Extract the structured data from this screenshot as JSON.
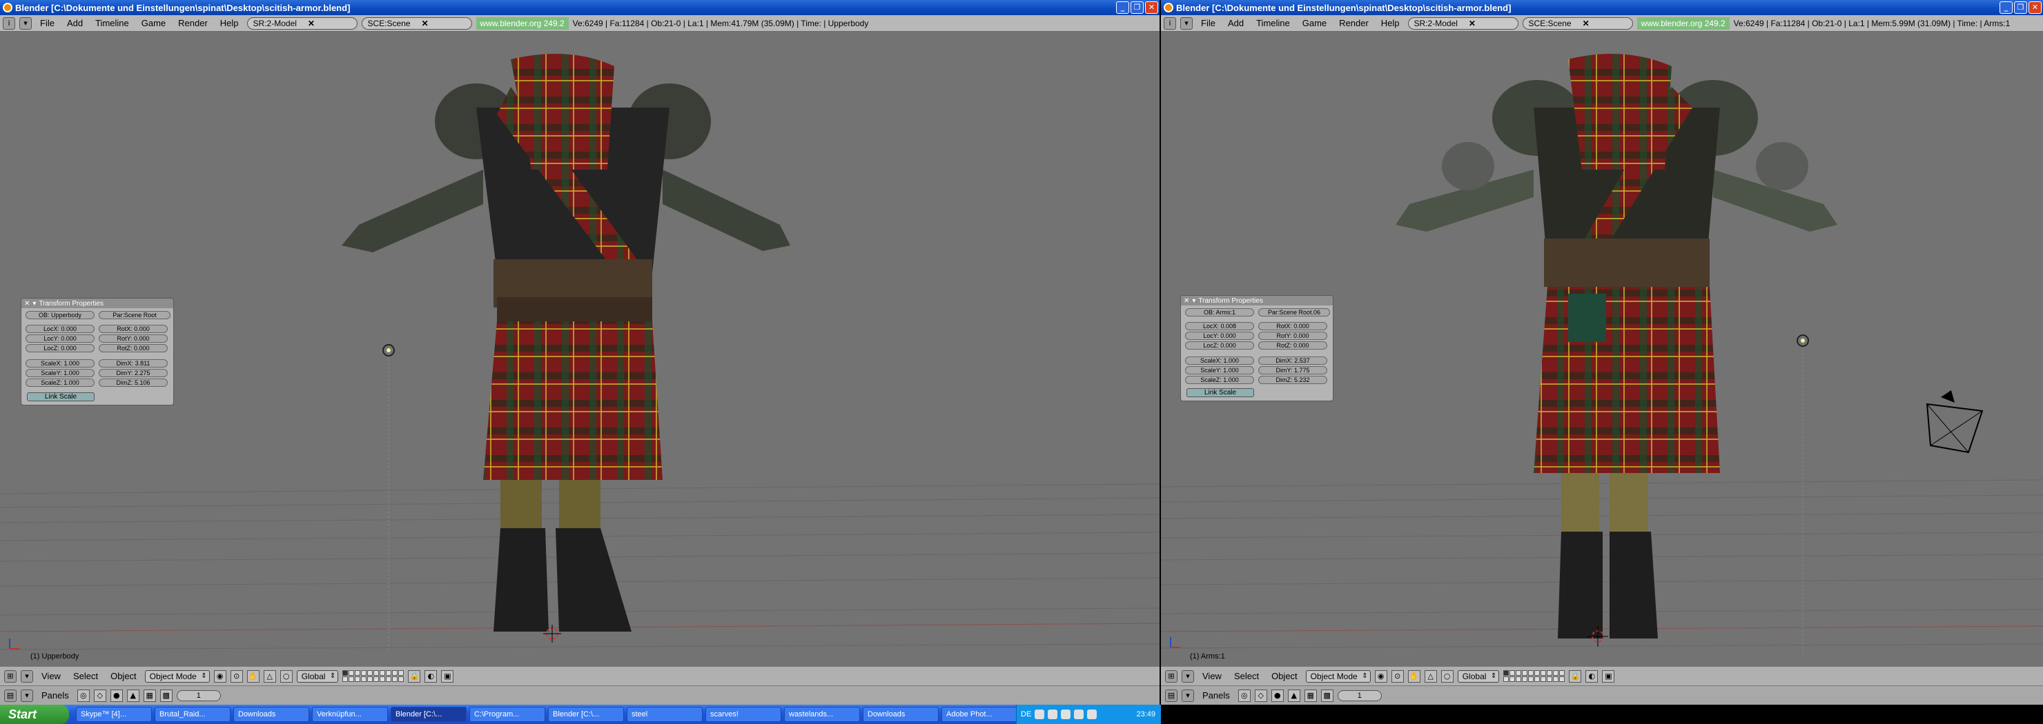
{
  "left": {
    "title": "Blender [C:\\Dokumente und Einstellungen\\spinat\\Desktop\\scitish-armor.blend]",
    "menu": [
      "File",
      "Add",
      "Timeline",
      "Game",
      "Render",
      "Help"
    ],
    "screen": "SR:2-Model",
    "scene": "SCE:Scene",
    "link": "www.blender.org 249.2",
    "stats": "Ve:6249 | Fa:11284 | Ob:21-0 | La:1  | Mem:41.79M (35.09M)  | Time: | Upperbody",
    "viewport_label": "(1) Upperbody",
    "panel": {
      "title": "Transform Properties",
      "ob": "OB: Upperbody",
      "par": "Par:Scene Root",
      "loc": [
        "LocX: 0.000",
        "LocY: 0.000",
        "LocZ: 0.000"
      ],
      "rot": [
        "RotX: 0.000",
        "RotY: 0.000",
        "RotZ: 0.000"
      ],
      "scale": [
        "ScaleX: 1.000",
        "ScaleY: 1.000",
        "ScaleZ: 1.000"
      ],
      "dim": [
        "DimX: 3.811",
        "DimY: 2.275",
        "DimZ: 5.106"
      ],
      "link_scale": "Link Scale"
    },
    "bottom": {
      "view": "View",
      "select": "Select",
      "object": "Object",
      "mode": "Object Mode",
      "orientation": "Global",
      "panels": "Panels",
      "frame": "1"
    }
  },
  "right": {
    "title": "Blender [C:\\Dokumente und Einstellungen\\spinat\\Desktop\\scitish-armor.blend]",
    "menu": [
      "File",
      "Add",
      "Timeline",
      "Game",
      "Render",
      "Help"
    ],
    "screen": "SR:2-Model",
    "scene": "SCE:Scene",
    "link": "www.blender.org 249.2",
    "stats": "Ve:6249 | Fa:11284 | Ob:21-0 | La:1  | Mem:5.99M (31.09M)  | Time: | Arms:1",
    "viewport_label": "(1) Arms:1",
    "panel": {
      "title": "Transform Properties",
      "ob": "OB: Arms:1",
      "par": "Par:Scene Root.06",
      "loc": [
        "LocX: 0.008",
        "LocY: 0.000",
        "LocZ: 0.000"
      ],
      "rot": [
        "RotX: 0.000",
        "RotY: 0.000",
        "RotZ: 0.000"
      ],
      "scale": [
        "ScaleX: 1.000",
        "ScaleY: 1.000",
        "ScaleZ: 1.000"
      ],
      "dim": [
        "DimX: 2.537",
        "DimY: 1.775",
        "DimZ: 5.232"
      ],
      "link_scale": "Link Scale"
    },
    "bottom": {
      "view": "View",
      "select": "Select",
      "object": "Object",
      "mode": "Object Mode",
      "orientation": "Global",
      "panels": "Panels",
      "frame": "1"
    }
  },
  "taskbar": {
    "start": "Start",
    "tasks": [
      "Skype™ [4]...",
      "Brutal_Raid...",
      "Downloads",
      "Verknüpfun...",
      "Blender [C:\\...",
      "C:\\Program...",
      "Blender [C:\\...",
      "steel",
      "scarves!",
      "wastelands...",
      "Downloads",
      "Adobe Phot..."
    ],
    "lang": "DE",
    "clock": "23:49"
  },
  "colors": {
    "viewport": "#737373",
    "plaid_red": "#7a1a1a",
    "plaid_green": "#1f4a2a",
    "header": "#b8b8b8"
  }
}
